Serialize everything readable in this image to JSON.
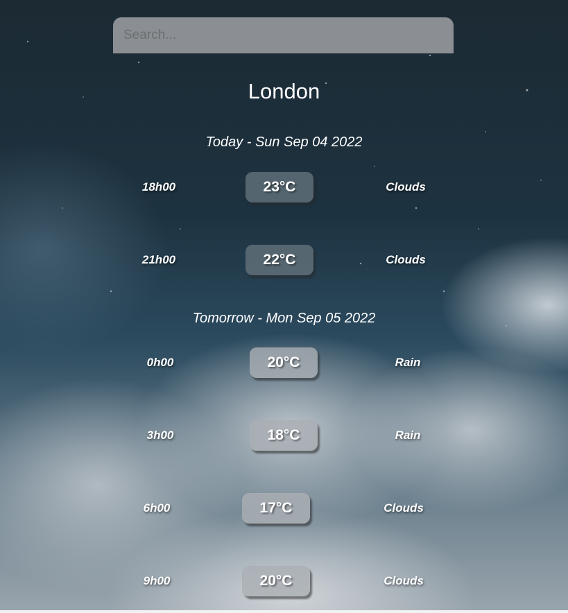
{
  "search": {
    "placeholder": "Search..."
  },
  "city": "London",
  "days": [
    {
      "heading": "Today - Sun Sep 04 2022",
      "forecasts": [
        {
          "time": "18h00",
          "temp": "23°C",
          "condition": "Clouds"
        },
        {
          "time": "21h00",
          "temp": "22°C",
          "condition": "Clouds"
        }
      ]
    },
    {
      "heading": "Tomorrow - Mon Sep 05 2022",
      "forecasts": [
        {
          "time": "0h00",
          "temp": "20°C",
          "condition": "Rain"
        },
        {
          "time": "3h00",
          "temp": "18°C",
          "condition": "Rain"
        },
        {
          "time": "6h00",
          "temp": "17°C",
          "condition": "Clouds"
        },
        {
          "time": "9h00",
          "temp": "20°C",
          "condition": "Clouds"
        }
      ]
    }
  ],
  "colors": {
    "sky_top": "#1c2a33",
    "sky_bottom": "#9aa5ad",
    "search_bg": "#8b8f93",
    "text": "#ffffff"
  }
}
